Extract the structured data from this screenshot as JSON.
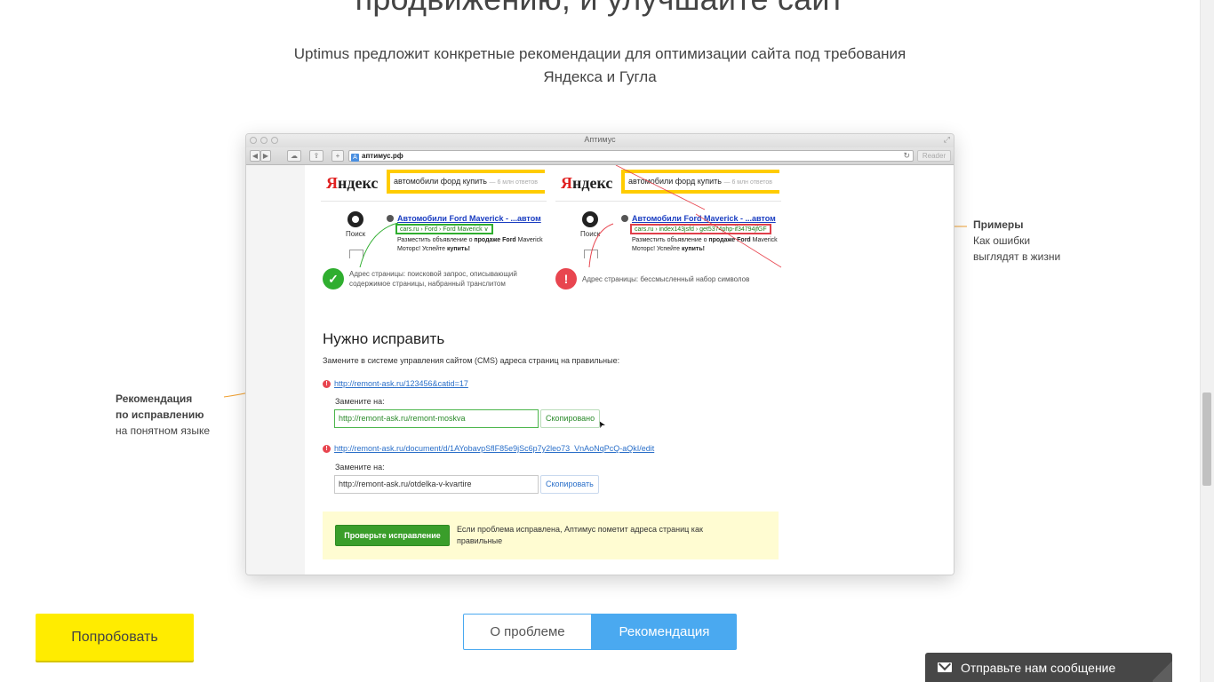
{
  "hero": {
    "title": "продвижению, и улучшайте сайт",
    "subtitle_line1": "Uptimus предложит конкретные рекомендации для оптимизации сайта под требования",
    "subtitle_line2": "Яндекса и Гугла"
  },
  "browser": {
    "window_title": "Аптимус",
    "url_badge": "A",
    "url": "аптимус.рф",
    "reader_label": "Reader",
    "back_glyph": "◀",
    "forward_glyph": "▶",
    "cloud_glyph": "☁",
    "share_glyph": "⇪",
    "new_tab_glyph": "+",
    "reload_glyph": "↻",
    "expand_glyph": "⤢"
  },
  "snippets": {
    "logo_first": "Я",
    "logo_rest": "ндекс",
    "query": "автомобили форд купить",
    "answers_hint": "— 6 млн ответов",
    "icon_label": "Поиск",
    "good": {
      "title": "Автомобили Ford Maverick - ...автом",
      "url": "cars.ru › Ford › Ford Maverick ∨",
      "desc_line1_pre": "Разместить объявление о ",
      "desc_line1_bold": "продаже Ford",
      "desc_line1_post": " Maverick",
      "desc_line2_pre": "Моторс! Успейте ",
      "desc_line2_bold": "купить!",
      "status": "Адрес страницы: поисковой запрос, описывающий содержимое страницы, набранный транслитом"
    },
    "bad": {
      "title": "Автомобили Ford Maverick - ...автом",
      "url": "cars.ru › index143jsfd › get5374php-if34794jfGF",
      "desc_line1_pre": "Разместить объявление о ",
      "desc_line1_bold": "продаже Ford",
      "desc_line1_post": " Maverick",
      "desc_line2_pre": "Моторс! Успейте ",
      "desc_line2_bold": "купить!",
      "status": "Адрес страницы: бессмысленный набор символов"
    },
    "ok_glyph": "✓",
    "bad_glyph": "!"
  },
  "fix": {
    "heading": "Нужно исправить",
    "intro": "Замените в системе управления сайтом (CMS) адреса страниц на правильные:",
    "warn_glyph": "!",
    "items": [
      {
        "bad_url": "http://remont-ask.ru/123456&catid=17",
        "replace_label": "Замените на:",
        "new_url": "http://remont-ask.ru/remont-moskva",
        "copy_label": "Скопировано"
      },
      {
        "bad_url": "http://remont-ask.ru/document/d/1AYobavpSflF85e9jSc6p7y2leo73_VnAoNqPcQ-aQkI/edit",
        "replace_label": "Замените на:",
        "new_url": "http://remont-ask.ru/otdelka-v-kvartire",
        "copy_label": "Скопировать"
      }
    ],
    "check_button": "Проверьте исправление",
    "check_note": "Если проблема исправлена, Аптимус пометит адреса страниц как правильные",
    "cursor_glyph": "➤"
  },
  "annotations": {
    "right_title": "Примеры",
    "right_line1": "Как ошибки",
    "right_line2": "выглядят в жизни",
    "left_title_line1": "Рекомендация",
    "left_title_line2": "по исправлению",
    "left_line": "на понятном языке"
  },
  "controls": {
    "try_button": "Попробовать",
    "tab_problem": "О проблеме",
    "tab_recommendation": "Рекомендация",
    "active_tab": "Рекомендация",
    "chat_label": "Отправьте нам сообщение"
  },
  "colors": {
    "accent_blue": "#4aa9f0",
    "try_yellow": "#ffec00",
    "annotation_orange": "#f0a030",
    "ok_green": "#2fae2f",
    "error_red": "#e8454f"
  }
}
